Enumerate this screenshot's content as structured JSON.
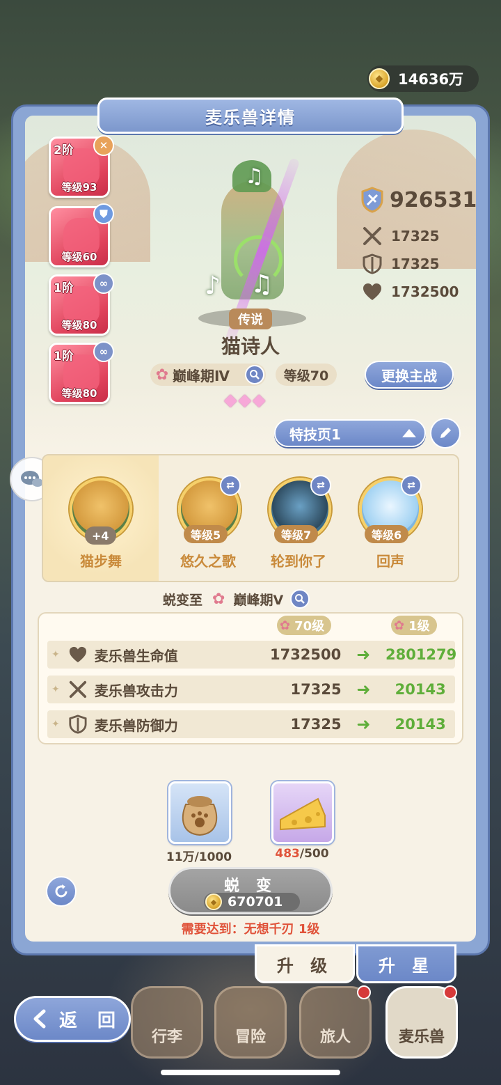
{
  "currency": {
    "gold": "14636万"
  },
  "panel": {
    "title": "麦乐兽详情"
  },
  "cards": [
    {
      "tier": "2阶",
      "level": "等级93",
      "badge": "x"
    },
    {
      "tier": "",
      "level": "等级60",
      "badge": "shield"
    },
    {
      "tier": "1阶",
      "level": "等级80",
      "badge": "link"
    },
    {
      "tier": "1阶",
      "level": "等级80",
      "badge": "link"
    }
  ],
  "pet": {
    "rarity": "传说",
    "name": "猫诗人",
    "stage": "巅峰期Ⅳ",
    "level": "等级70",
    "stars": 3,
    "switch_label": "更换主战"
  },
  "stats": {
    "power": "926531",
    "attack": "17325",
    "defense": "17325",
    "hp": "1732500"
  },
  "skills": {
    "page": "特技页1",
    "items": [
      {
        "name": "猫步舞",
        "badge": "+4"
      },
      {
        "name": "悠久之歌",
        "level": "等级5"
      },
      {
        "name": "轮到你了",
        "level": "等级7"
      },
      {
        "name": "回声",
        "level": "等级6"
      }
    ]
  },
  "evolve": {
    "to_label": "蜕变至",
    "to_stage": "巅峰期Ⅴ",
    "from_level": "70级",
    "to_level": "1级",
    "rows": [
      {
        "label": "麦乐兽生命值",
        "current": "1732500",
        "next": "2801279"
      },
      {
        "label": "麦乐兽攻击力",
        "current": "17325",
        "next": "20143"
      },
      {
        "label": "麦乐兽防御力",
        "current": "17325",
        "next": "20143"
      }
    ],
    "materials": [
      {
        "have": "11万",
        "need": "/1000"
      },
      {
        "have": "483",
        "need": "/500"
      }
    ],
    "button_label": "蜕 变",
    "cost": "670701",
    "requirement": "需要达到：无想千刃 1级"
  },
  "tabs": {
    "upgrade": "升 级",
    "star": "升 星"
  },
  "nav": {
    "back": "返 回",
    "items": [
      "行李",
      "冒险",
      "旅人",
      "麦乐兽"
    ]
  },
  "colors": {
    "accent": "#6c88c8",
    "green": "#5fae3a",
    "red": "#e0533a"
  }
}
